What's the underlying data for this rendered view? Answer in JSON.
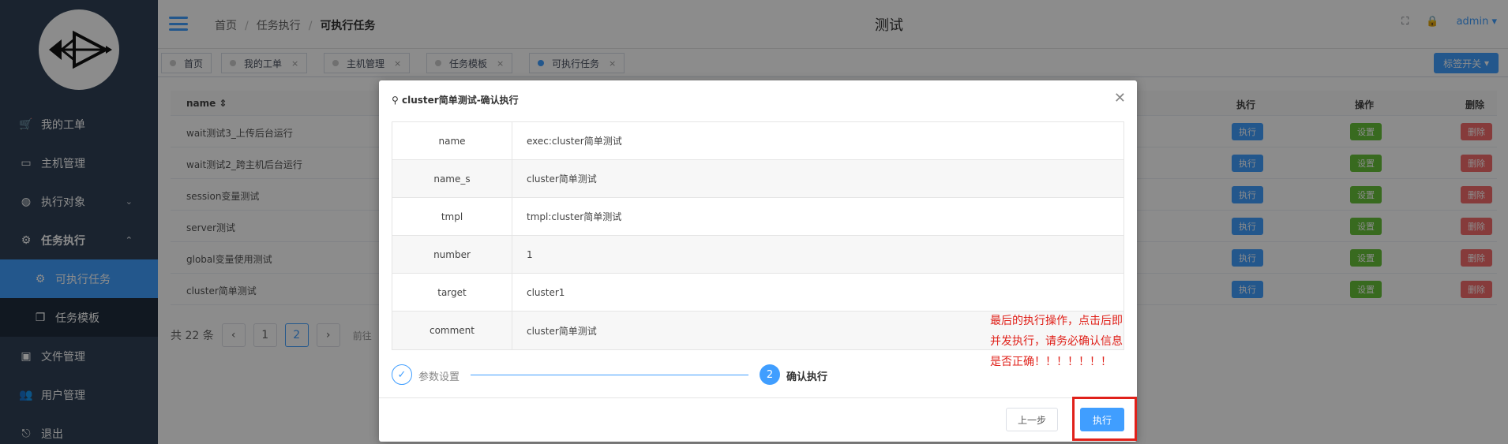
{
  "sidebar": {
    "items": [
      {
        "label": "我的工单",
        "icon": "cart-icon"
      },
      {
        "label": "主机管理",
        "icon": "monitor-icon"
      },
      {
        "label": "执行对象",
        "icon": "globe-icon",
        "arrow": "⌄"
      },
      {
        "label": "任务执行",
        "icon": "gear-icon",
        "arrow": "⌃"
      },
      {
        "label": "可执行任务",
        "icon": "gear-icon"
      },
      {
        "label": "任务模板",
        "icon": "copy-icon"
      },
      {
        "label": "文件管理",
        "icon": "briefcase-icon"
      },
      {
        "label": "用户管理",
        "icon": "users-icon"
      },
      {
        "label": "退出",
        "icon": "logout-icon"
      }
    ]
  },
  "navbar": {
    "breadcrumb": [
      "首页",
      "任务执行",
      "可执行任务"
    ],
    "title": "测试",
    "user": "admin"
  },
  "tags": [
    {
      "label": "首页"
    },
    {
      "label": "我的工单",
      "close": "×"
    },
    {
      "label": "主机管理",
      "close": "×"
    },
    {
      "label": "任务模板",
      "close": "×"
    },
    {
      "label": "可执行任务",
      "close": "×"
    }
  ],
  "tag_switch": "标签开关",
  "table": {
    "headers": {
      "name": "name",
      "exec": "执行",
      "ops": "操作",
      "del": "删除"
    },
    "rows": [
      "wait测试3_上传后台运行",
      "wait测试2_跨主机后台运行",
      "session变量测试",
      "server测试",
      "global变量使用测试",
      "cluster简单测试"
    ],
    "btn_exec": "执行",
    "btn_set": "设置",
    "btn_del": "删除"
  },
  "pager": {
    "total": "共 22 条",
    "pages": [
      "1",
      "2"
    ],
    "current": "2",
    "goto": "前往"
  },
  "dialog": {
    "title": "cluster简单测试-确认执行",
    "params": [
      {
        "key": "name",
        "value": "exec:cluster简单测试"
      },
      {
        "key": "name_s",
        "value": "cluster简单测试"
      },
      {
        "key": "tmpl",
        "value": "tmpl:cluster简单测试"
      },
      {
        "key": "number",
        "value": "1"
      },
      {
        "key": "target",
        "value": "cluster1"
      },
      {
        "key": "comment",
        "value": "cluster简单测试"
      }
    ],
    "step1": "参数设置",
    "step2_num": "2",
    "step2": "确认执行",
    "btn_prev": "上一步",
    "btn_exec": "执行"
  },
  "annotation": "最后的执行操作，点击后即并发执行，请务必确认信息是否正确！！！！！！！",
  "colors": {
    "primary": "#409eff",
    "success": "#67c23a",
    "danger": "#f56c6c",
    "sidebar": "#304156",
    "annotation": "#e0211a"
  }
}
